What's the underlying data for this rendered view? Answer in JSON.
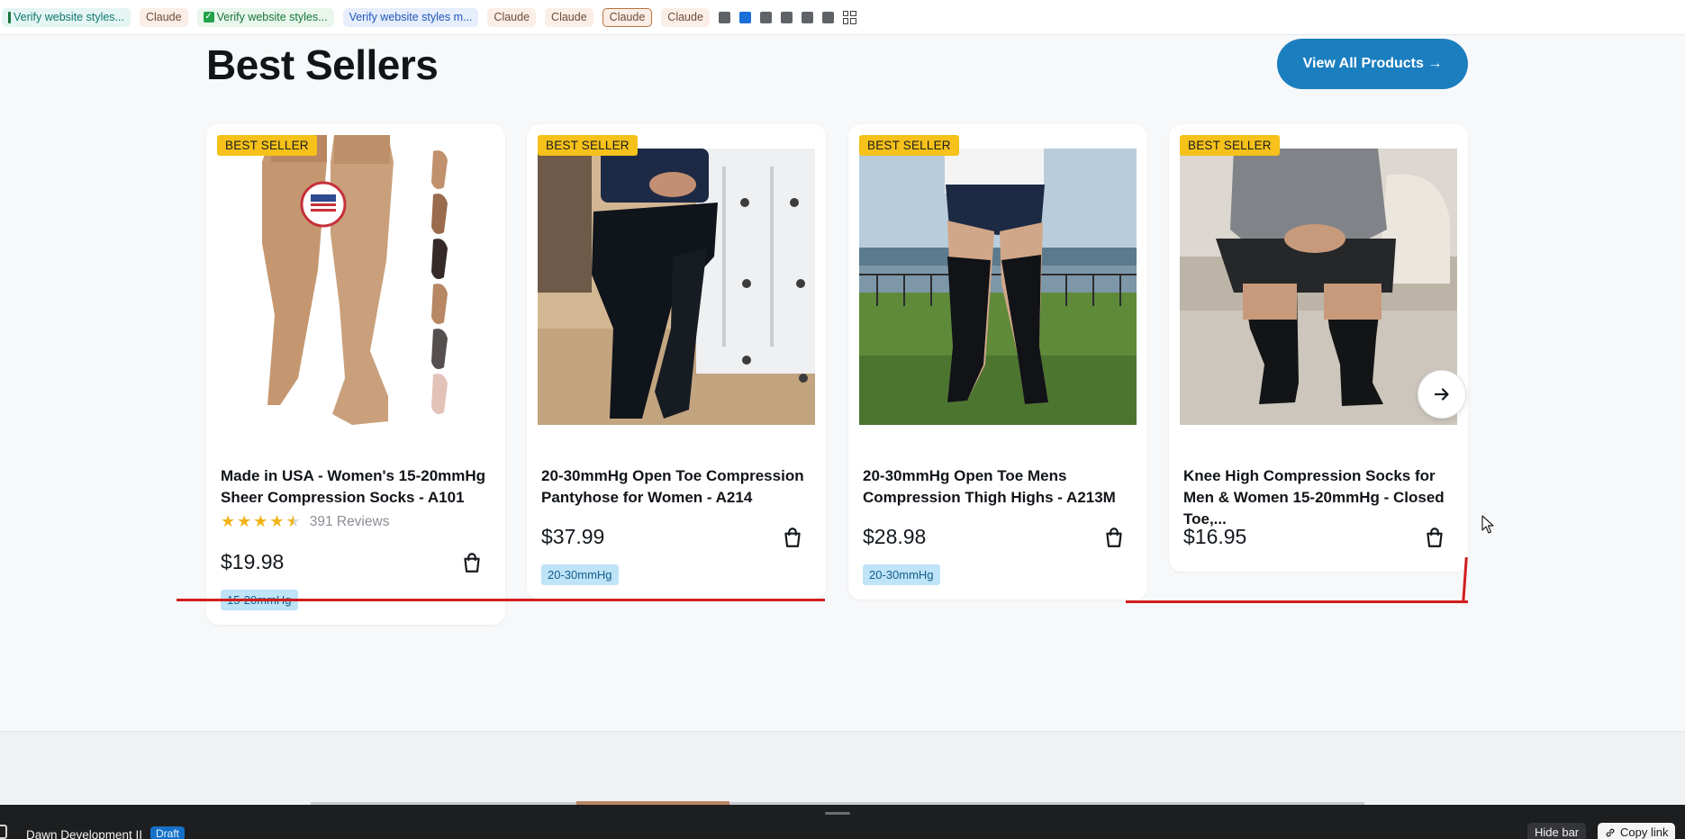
{
  "tabs": [
    {
      "label": "Verify website styles...",
      "style": "teal"
    },
    {
      "label": "Claude",
      "style": "claude"
    },
    {
      "label": "Verify website styles...",
      "style": "green"
    },
    {
      "label": "Verify website styles m...",
      "style": "blue"
    },
    {
      "label": "Claude",
      "style": "claude"
    },
    {
      "label": "Claude",
      "style": "claude"
    },
    {
      "label": "Claude",
      "style": "claude-active"
    },
    {
      "label": "Claude",
      "style": "claude"
    }
  ],
  "section": {
    "title": "Best Sellers",
    "view_all_label": "View All Products →"
  },
  "products": [
    {
      "badge": "BEST SELLER",
      "title": "Made in USA - Women's 15-20mmHg Sheer Compression Socks - A101",
      "rating": 4.5,
      "reviews": "391 Reviews",
      "price": "$19.98",
      "tag": "15-20mmHg"
    },
    {
      "badge": "BEST SELLER",
      "title": "20-30mmHg Open Toe Compression Pantyhose for Women - A214",
      "price": "$37.99",
      "tag": "20-30mmHg"
    },
    {
      "badge": "BEST SELLER",
      "title": "20-30mmHg Open Toe Mens Compression Thigh Highs - A213M",
      "price": "$28.98",
      "tag": "20-30mmHg"
    },
    {
      "badge": "BEST SELLER",
      "title": "Knee High Compression Socks for Men & Women 15-20mmHg - Closed Toe,...",
      "price": "$16.95"
    }
  ],
  "icons": {
    "cart": "shopping-bag-icon",
    "next": "arrow-right-icon",
    "star": "star-icon"
  },
  "bottom_bar": {
    "store_name": "Dawn Development II",
    "status": "Draft",
    "hide_label": "Hide bar",
    "copy_label": "Copy link"
  },
  "colors": {
    "accent": "#1b7ebf",
    "badge": "#f5c11a",
    "tag": "#bfe3f7",
    "annotation_red": "#d21d1d"
  }
}
